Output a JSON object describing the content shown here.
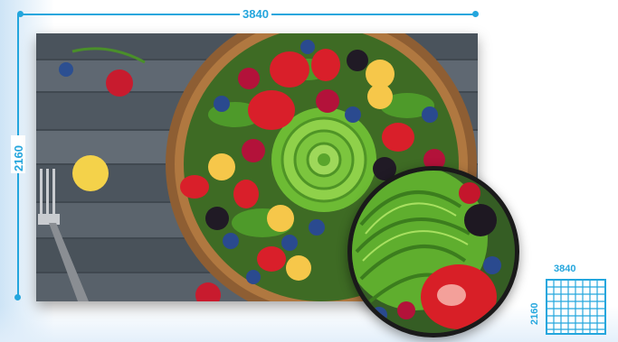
{
  "dimensions": {
    "width_label": "3840",
    "height_label": "2160"
  },
  "legend": {
    "width_label": "3840",
    "height_label": "2160"
  },
  "colors": {
    "accent": "#24a6dd",
    "wood": "#5d6670",
    "bowl": "#9a6a3c"
  }
}
